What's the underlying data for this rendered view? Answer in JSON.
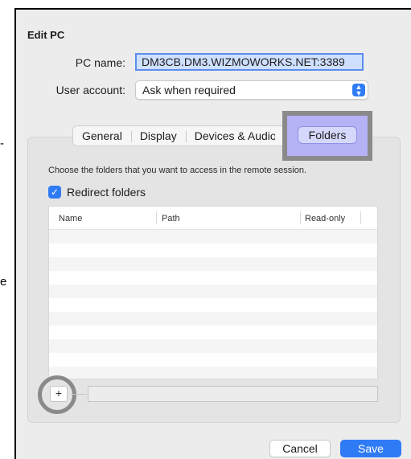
{
  "outside": {
    "dash": "-",
    "e_fragment": "e"
  },
  "dialog": {
    "title": "Edit PC",
    "pc_name_label": "PC name:",
    "pc_name_value": "DM3CB.DM3.WIZMOWORKS.NET:3389",
    "user_account_label": "User account:",
    "user_account_value": "Ask when required"
  },
  "tabs": {
    "general": "General",
    "display": "Display",
    "devices": "Devices & Audio",
    "folders": "Folders",
    "selected": "Folders"
  },
  "folders": {
    "description": "Choose the folders that you want to access in the remote session.",
    "redirect_label": "Redirect folders",
    "redirect_checked": true,
    "columns": [
      "Name",
      "Path",
      "Read-only"
    ],
    "add_label": "+"
  },
  "buttons": {
    "cancel": "Cancel",
    "save": "Save"
  },
  "colors": {
    "accent": "#2f7bf5",
    "highlight": "#b5b2f6"
  }
}
